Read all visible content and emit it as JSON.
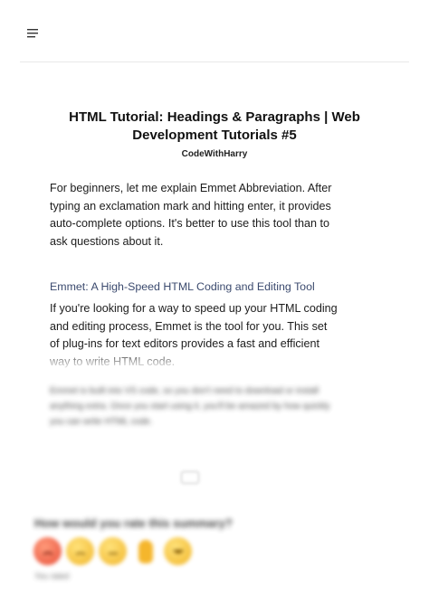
{
  "header": {
    "menu_icon": "hamburger-menu-icon"
  },
  "article": {
    "title": "HTML Tutorial: Headings & Paragraphs | Web Development Tutorials #5",
    "author": "CodeWithHarry",
    "paragraph1": "For beginners, let me explain Emmet Abbreviation. After typing an exclamation mark and hitting enter, it provides auto-complete options. It's better to use this tool than to ask questions about it.",
    "subheading": "Emmet: A High-Speed HTML Coding and Editing Tool",
    "paragraph2": "If you're looking for a way to speed up your HTML coding and editing process, Emmet is the tool for you. This set of plug-ins for text editors provides a fast and efficient way to write HTML code.",
    "paragraph3_blurred": "Emmet is built into VS code, so you don't need to download or install anything extra. Once you start using it, you'll be amazed by how quickly you can write HTML code."
  },
  "expand_icon": "expand-icon",
  "rating": {
    "question": "How would you rate this summary?",
    "options": [
      {
        "icon": "angry-face-emoji"
      },
      {
        "icon": "sad-face-emoji"
      },
      {
        "icon": "neutral-face-emoji"
      },
      {
        "icon": "ok-hand-emoji"
      },
      {
        "icon": "grinning-face-emoji"
      }
    ],
    "status": "You rated"
  }
}
